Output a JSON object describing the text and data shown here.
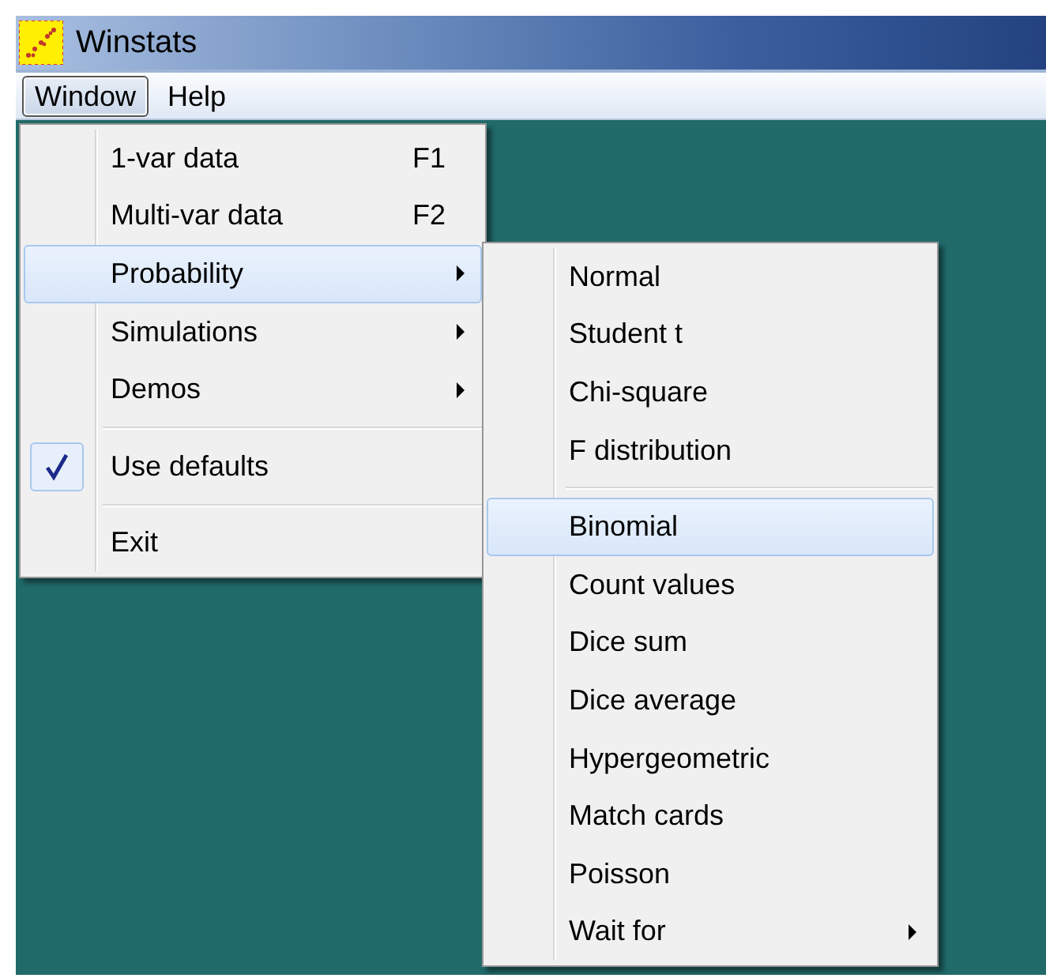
{
  "window": {
    "title": "Winstats"
  },
  "menu_bar": [
    {
      "label": "Window",
      "selected": true
    },
    {
      "label": "Help",
      "selected": false
    }
  ],
  "menu": [
    {
      "kind": "item",
      "label": "1-var data",
      "shortcut": "F1",
      "submenu": false,
      "selected": false,
      "checked": false
    },
    {
      "kind": "item",
      "label": "Multi-var data",
      "shortcut": "F2",
      "submenu": false,
      "selected": false,
      "checked": false
    },
    {
      "kind": "item",
      "label": "Probability",
      "submenu": true,
      "selected": true,
      "checked": false
    },
    {
      "kind": "item",
      "label": "Simulations",
      "submenu": true,
      "selected": false,
      "checked": false
    },
    {
      "kind": "item",
      "label": "Demos",
      "submenu": true,
      "selected": false,
      "checked": false
    },
    {
      "kind": "separator"
    },
    {
      "kind": "item",
      "label": "Use defaults",
      "submenu": false,
      "selected": false,
      "checked": true
    },
    {
      "kind": "separator"
    },
    {
      "kind": "item",
      "label": "Exit",
      "submenu": false,
      "selected": false,
      "checked": false
    }
  ],
  "submenu": [
    {
      "kind": "item",
      "label": "Normal",
      "submenu": false,
      "selected": false
    },
    {
      "kind": "item",
      "label": "Student t",
      "submenu": false,
      "selected": false
    },
    {
      "kind": "item",
      "label": "Chi-square",
      "submenu": false,
      "selected": false
    },
    {
      "kind": "item",
      "label": "F distribution",
      "submenu": false,
      "selected": false
    },
    {
      "kind": "separator"
    },
    {
      "kind": "item",
      "label": "Binomial",
      "submenu": false,
      "selected": true
    },
    {
      "kind": "item",
      "label": "Count values",
      "submenu": false,
      "selected": false
    },
    {
      "kind": "item",
      "label": "Dice sum",
      "submenu": false,
      "selected": false
    },
    {
      "kind": "item",
      "label": "Dice average",
      "submenu": false,
      "selected": false
    },
    {
      "kind": "item",
      "label": "Hypergeometric",
      "submenu": false,
      "selected": false
    },
    {
      "kind": "item",
      "label": "Match cards",
      "submenu": false,
      "selected": false
    },
    {
      "kind": "item",
      "label": "Poisson",
      "submenu": false,
      "selected": false
    },
    {
      "kind": "item",
      "label": "Wait for",
      "submenu": true,
      "selected": false
    }
  ]
}
